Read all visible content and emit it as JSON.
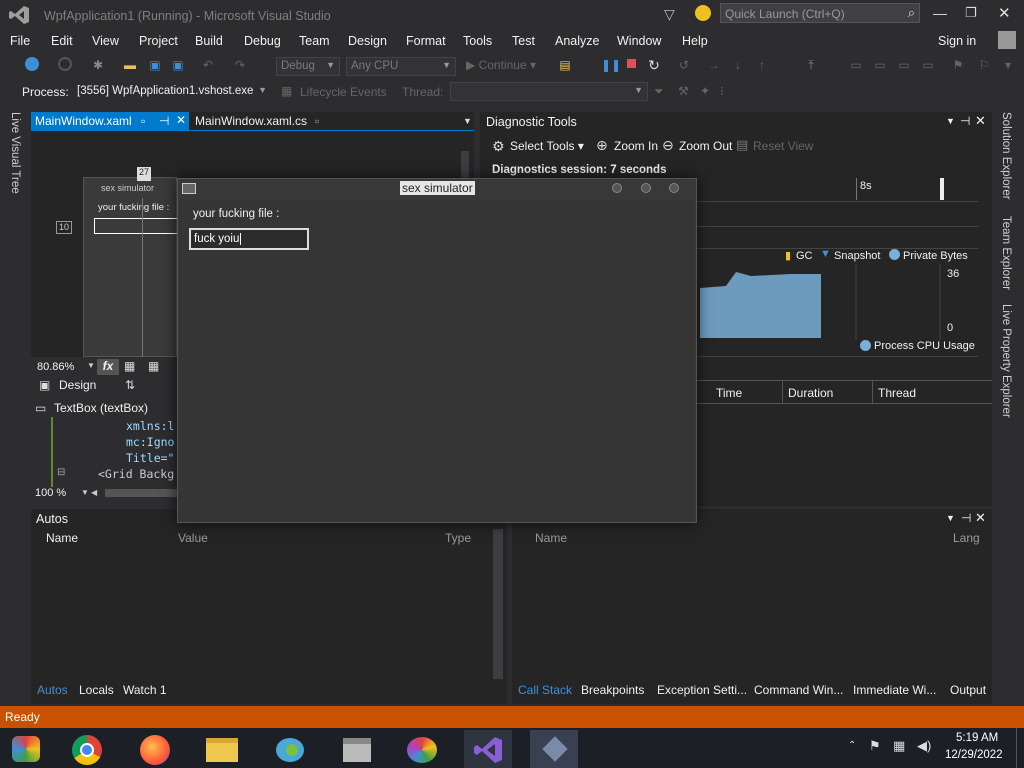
{
  "window": {
    "title": "WpfApplication1 (Running) - Microsoft Visual Studio",
    "quick_launch": "Quick Launch (Ctrl+Q)",
    "sign_in": "Sign in"
  },
  "menu": [
    "File",
    "Edit",
    "View",
    "Project",
    "Build",
    "Debug",
    "Team",
    "Design",
    "Format",
    "Tools",
    "Test",
    "Analyze",
    "Window",
    "Help"
  ],
  "toolbar": {
    "config": "Debug",
    "platform": "Any CPU",
    "continue": "Continue"
  },
  "process": {
    "label": "Process:",
    "value": "[3556] WpfApplication1.vshost.exe",
    "lifecycle": "Lifecycle Events",
    "thread": "Thread:"
  },
  "left_strip": "Live Visual Tree",
  "right_strip": [
    "Solution Explorer",
    "Team Explorer",
    "Live Property Explorer"
  ],
  "editor": {
    "tab1": "MainWindow.xaml",
    "tab2": "MainWindow.xaml.cs",
    "zoom": "80.86%",
    "fx": "fx",
    "design_tab": "Design",
    "element": "TextBox (textBox)",
    "code": [
      "xmlns:l",
      "mc:Igno",
      "Title=\"",
      "<Grid Backg"
    ],
    "code_zoom": "100 %",
    "ruler_top": "27",
    "ruler_left": "10",
    "mini_title": "sex simulator",
    "mini_label": "your fucking file :"
  },
  "diag": {
    "title": "Diagnostic Tools",
    "select_tools": "Select Tools",
    "zoom_in": "Zoom In",
    "zoom_out": "Zoom Out",
    "reset_view": "Reset View",
    "session": "Diagnostics session: 7 seconds",
    "tick_8s": "8s",
    "legend_gc": "GC",
    "legend_snapshot": "Snapshot",
    "legend_private": "Private Bytes",
    "max": "36",
    "min": "0",
    "cpu": "Process CPU Usage",
    "cols": [
      "Time",
      "Duration",
      "Thread"
    ]
  },
  "running": {
    "title": "sex simulator",
    "label": "your fucking file :",
    "textbox": "fuck yoiu"
  },
  "autos": {
    "title": "Autos",
    "cols": [
      "Name",
      "Value",
      "Type"
    ],
    "tabs": [
      "Autos",
      "Locals",
      "Watch 1"
    ]
  },
  "callstack": {
    "cols": [
      "Name",
      "Lang"
    ],
    "tabs": [
      "Call Stack",
      "Breakpoints",
      "Exception Setti...",
      "Command Win...",
      "Immediate Wi...",
      "Output"
    ]
  },
  "status": "Ready",
  "clock": {
    "time": "5:19 AM",
    "date": "12/29/2022"
  },
  "colors": {
    "accent": "#007acc",
    "status": "#ca5100",
    "bg": "#2d2d30"
  }
}
